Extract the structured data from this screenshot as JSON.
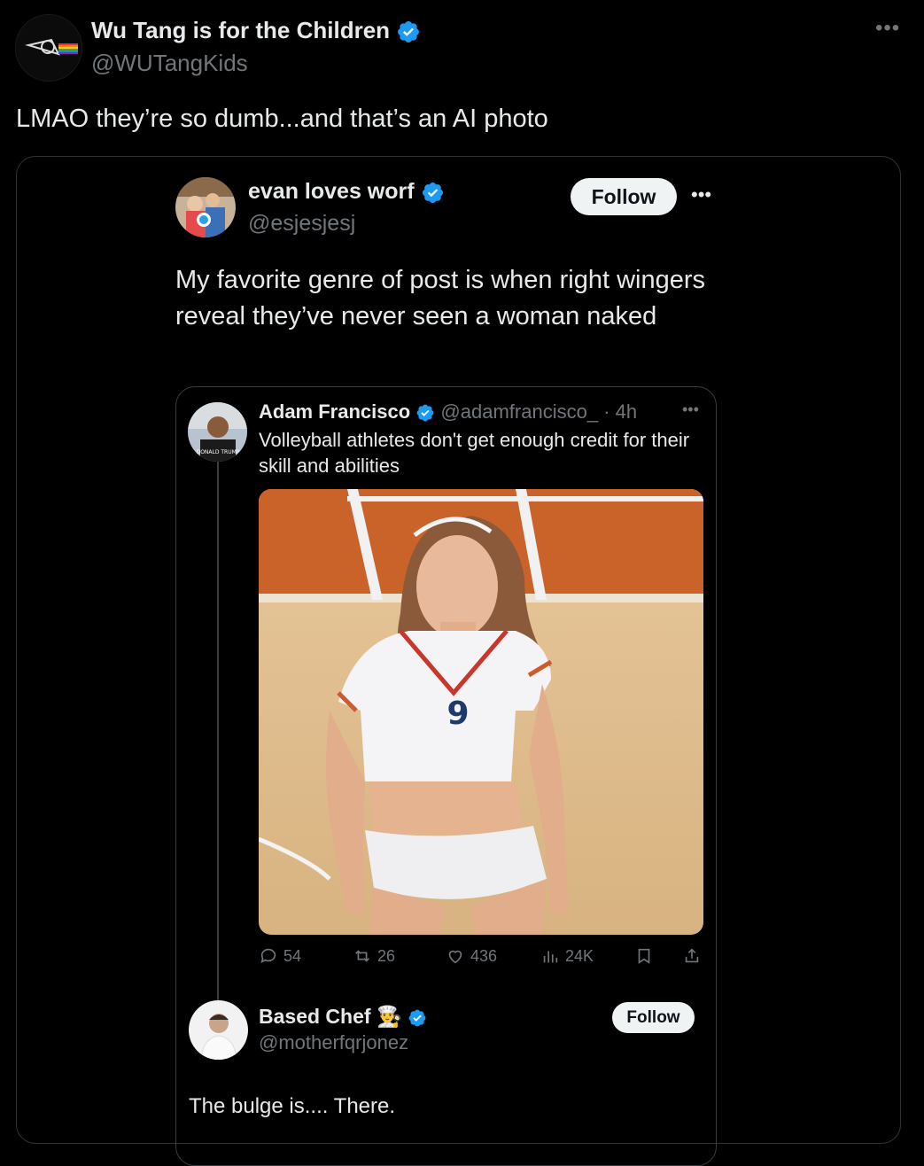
{
  "outer_post": {
    "display_name": "Wu Tang is for the Children",
    "handle": "@WUTangKids",
    "text": "LMAO they’re so dumb...and that’s an AI photo",
    "more_icon": "more-horizontal-icon"
  },
  "quoted_post": {
    "display_name": "evan loves worf",
    "handle": "@esjesjesj",
    "follow_label": "Follow",
    "text": "My favorite genre of post is when right wingers reveal they’ve never seen a woman naked"
  },
  "screenshot": {
    "original_post": {
      "display_name": "Adam Francisco",
      "meta": "@adamfrancisco_ · 4h",
      "text": "Volleyball athletes don't get enough credit for their skill and abilities",
      "photo_description_icon": "volleyball-player-photo",
      "jersey_number": "9",
      "actions": {
        "replies": "54",
        "reposts": "26",
        "likes": "436",
        "views": "24K"
      }
    },
    "reply": {
      "display_name": "Based Chef",
      "emoji": "👨‍🍳",
      "handle": "@motherfqrjonez",
      "follow_label": "Follow",
      "text": "The bulge is.... There."
    }
  },
  "colors": {
    "background": "#000000",
    "verified": "#1d9bf0",
    "muted": "#71767b",
    "text": "#e7e9ea"
  }
}
